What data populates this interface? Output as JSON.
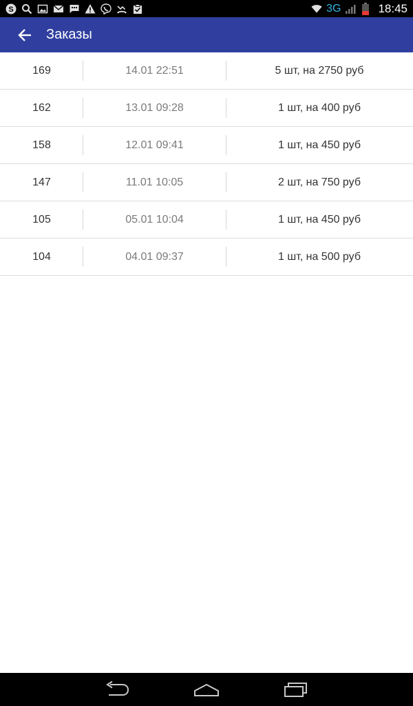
{
  "status_bar": {
    "left_icons": [
      "skype-icon",
      "search-icon",
      "image-icon",
      "gmail-icon",
      "message-icon",
      "warning-icon",
      "viber-icon",
      "missed-call-icon",
      "clipboard-check-icon"
    ],
    "network": "3G",
    "time": "18:45",
    "right_icons": [
      "wifi-icon",
      "signal-icon",
      "battery-icon"
    ]
  },
  "app_bar": {
    "title": "Заказы",
    "background": "#303f9f"
  },
  "orders": [
    {
      "id": "169",
      "datetime": "14.01 22:51",
      "summary": "5 шт, на 2750 руб"
    },
    {
      "id": "162",
      "datetime": "13.01 09:28",
      "summary": "1 шт, на 400 руб"
    },
    {
      "id": "158",
      "datetime": "12.01 09:41",
      "summary": "1 шт, на 450 руб"
    },
    {
      "id": "147",
      "datetime": "11.01 10:05",
      "summary": "2 шт, на 750 руб"
    },
    {
      "id": "105",
      "datetime": "05.01 10:04",
      "summary": "1 шт, на 450 руб"
    },
    {
      "id": "104",
      "datetime": "04.01 09:37",
      "summary": "1 шт, на 500 руб"
    }
  ],
  "nav_bar": {
    "buttons": [
      "back-nav-icon",
      "home-nav-icon",
      "recents-nav-icon"
    ]
  }
}
